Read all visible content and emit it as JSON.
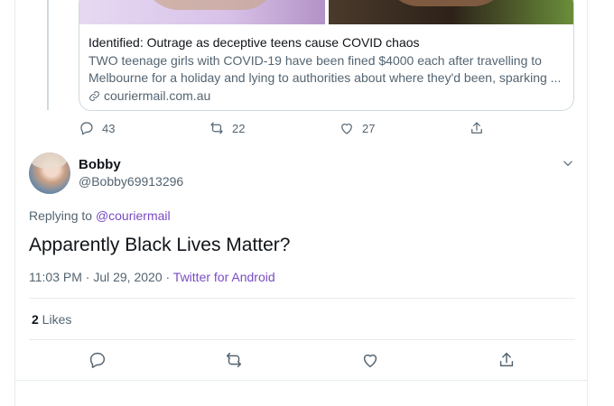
{
  "card": {
    "title": "Identified: Outrage as deceptive teens cause COVID chaos",
    "description": "TWO teenage girls with COVID-19 have been fined $4000 each after travelling to Melbourne for a holiday and lying to authorities about where they'd been, sparking ...",
    "domain": "couriermail.com.au"
  },
  "parent_actions": {
    "replies": "43",
    "retweets": "22",
    "likes": "27"
  },
  "reply": {
    "name": "Bobby",
    "handle": "@Bobby69913296",
    "replying_prefix": "Replying to ",
    "replying_to": "@couriermail",
    "text": "Apparently Black Lives Matter?",
    "timestamp": "11:03 PM · Jul 29, 2020 · ",
    "source": "Twitter for Android",
    "likes_count": "2",
    "likes_label": " Likes"
  },
  "colors": {
    "link": "#794bc4",
    "secondary_text": "#536471"
  }
}
